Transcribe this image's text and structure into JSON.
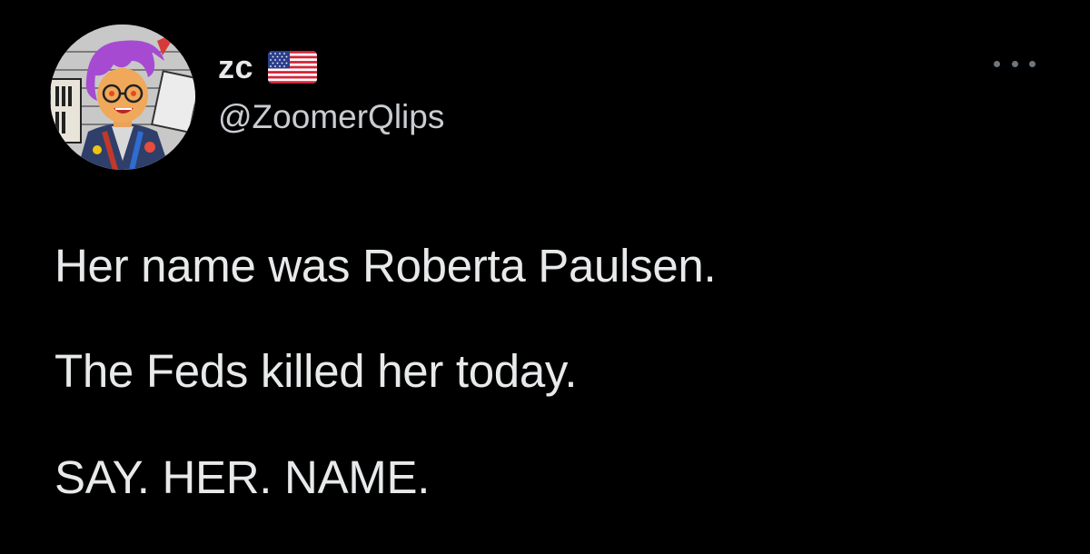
{
  "tweet": {
    "author": {
      "display_name": "zc",
      "handle": "@ZoomerQlips",
      "flag_icon": "us-flag-icon",
      "avatar_icon": "profile-avatar"
    },
    "menu_icon": "more-options-icon",
    "body_lines": [
      "Her name was Roberta Paulsen.",
      "The Feds killed her today.",
      "SAY. HER. NAME."
    ]
  },
  "colors": {
    "background": "#000000",
    "primary_text": "#e7e9ea",
    "secondary_text": "#c9cdd1",
    "icon": "#6e767d"
  }
}
